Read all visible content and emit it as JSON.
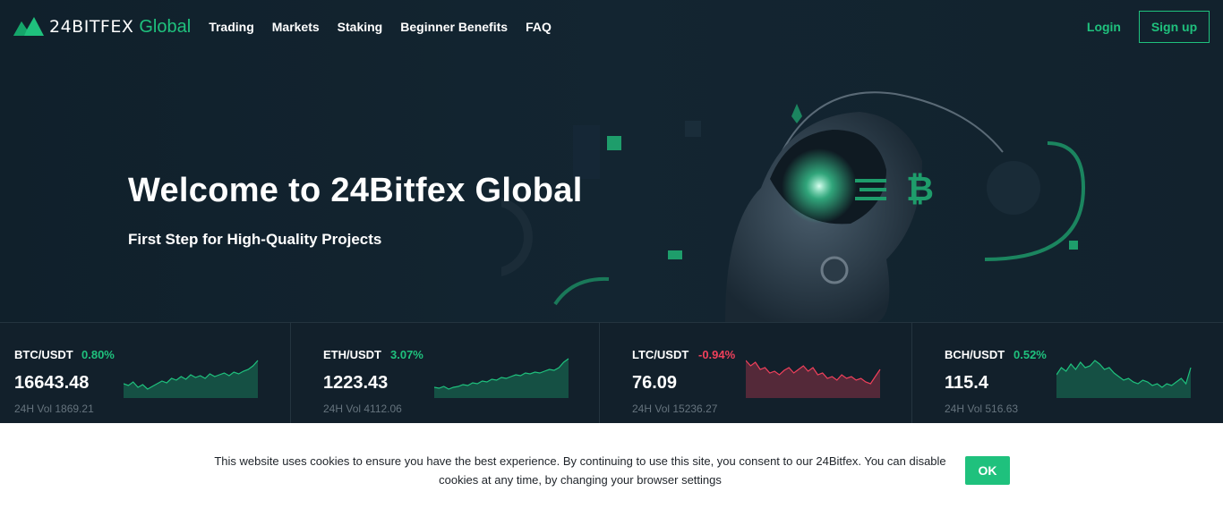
{
  "brand": {
    "name": "24BITFEX",
    "sub": "Global"
  },
  "nav": {
    "items": [
      "Trading",
      "Markets",
      "Staking",
      "Beginner Benefits",
      "FAQ"
    ]
  },
  "auth": {
    "login": "Login",
    "signup": "Sign up"
  },
  "hero": {
    "title": "Welcome to 24Bitfex Global",
    "subtitle": "First Step for High-Quality Projects"
  },
  "colors": {
    "accent": "#1fc17d",
    "negative": "#f0405b",
    "background": "#12202b"
  },
  "tickers": [
    {
      "pair": "BTC/USDT",
      "change": "0.80%",
      "trend": "up",
      "price": "16643.48",
      "vol": "24H Vol 1869.21"
    },
    {
      "pair": "ETH/USDT",
      "change": "3.07%",
      "trend": "up",
      "price": "1223.43",
      "vol": "24H Vol 4112.06"
    },
    {
      "pair": "LTC/USDT",
      "change": "-0.94%",
      "trend": "down",
      "price": "76.09",
      "vol": "24H Vol 15236.27"
    },
    {
      "pair": "BCH/USDT",
      "change": "0.52%",
      "trend": "up",
      "price": "115.4",
      "vol": "24H Vol 516.63"
    }
  ],
  "cookie": {
    "text": "This website uses cookies to ensure you have the best experience. By continuing to use this site, you consent to our 24Bitfex. You can disable cookies at any time, by changing your browser settings",
    "ok": "OK"
  }
}
